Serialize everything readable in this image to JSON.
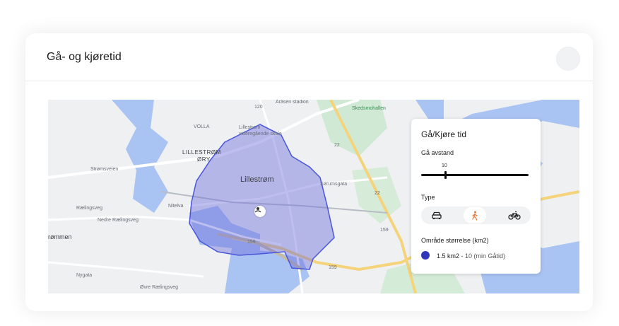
{
  "card": {
    "title": "Gå- og kjøretid"
  },
  "map": {
    "labels": {
      "city": "Lillestrøm",
      "district": "LILLESTRØM",
      "district2": "ØRY",
      "volla": "VOLLA",
      "arasen": "Åråsen stadion",
      "skedsmo": "Skedsmohallen",
      "school": "Lillestrøm",
      "school2": "videregående skole",
      "rommen": "Strømmen",
      "rommen_visible": "rømmen",
      "nitelva": "Nitelva",
      "stromsveien": "Strømsveien",
      "nedre_rael": "Nedre Rælingsveg",
      "ovre_rael": "Øvre Rælingsveg",
      "raelingsveg": "Rælingsveg",
      "nygata": "Nygata",
      "sorumsgata": "Sørumsgata",
      "road_120": "120",
      "road_159a": "159",
      "road_159b": "159",
      "road_159c": "159",
      "road_22a": "22",
      "road_22b": "22"
    }
  },
  "panel": {
    "title": "Gå/Kjøre tid",
    "distance_label": "Gå avstand",
    "slider_value": "10",
    "slider_fraction": 0.22,
    "type_label": "Type",
    "types": [
      {
        "name": "car",
        "icon": "car-icon",
        "active": false
      },
      {
        "name": "walk",
        "icon": "walk-icon",
        "active": true
      },
      {
        "name": "bike",
        "icon": "bike-icon",
        "active": false
      }
    ],
    "area_label": "Område størrelse (km2)",
    "legend_area": "1.5 km2",
    "legend_detail": "- 10 (min Gåtid)",
    "accent_color": "#3036b8",
    "active_type_color": "#f07a3a"
  }
}
